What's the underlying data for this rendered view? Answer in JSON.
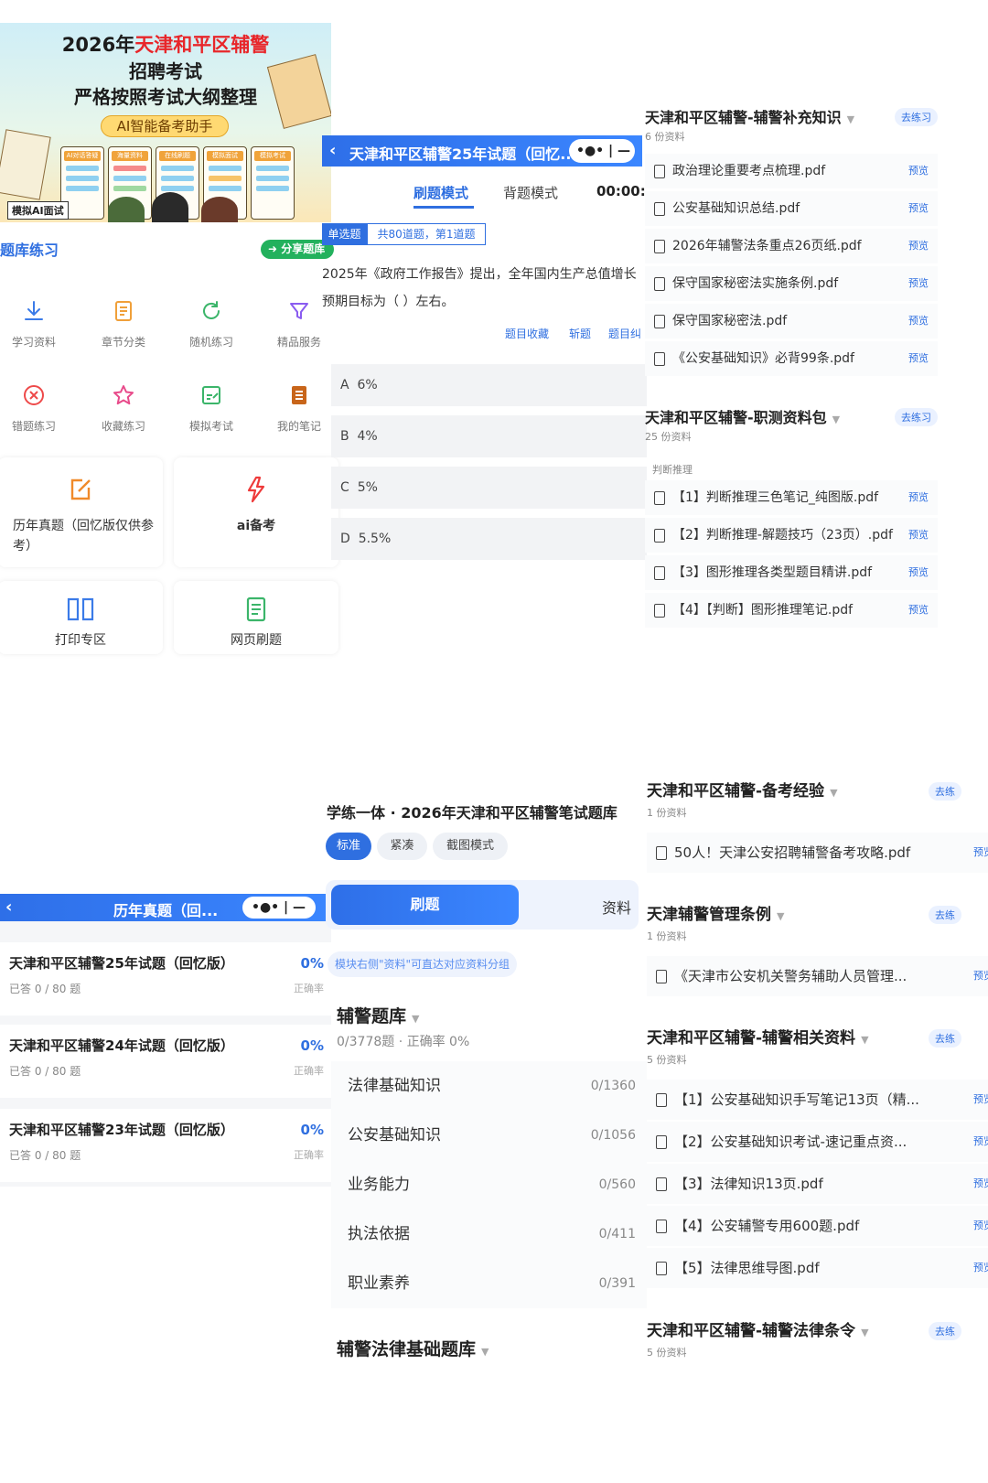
{
  "banner": {
    "title_prefix": "2026年",
    "title_red": "天津和平区辅警",
    "title_line2": "招聘考试",
    "title_line3": "严格按照考试大纲整理",
    "pill": "AI智能备考助手",
    "cards": [
      "AI对话答疑",
      "海量资料",
      "在线刷题",
      "模拟面试",
      "模拟考试"
    ],
    "tag": "模拟AI面试"
  },
  "tiku": {
    "title": "题库练习",
    "share": "分享题库",
    "grid": [
      {
        "label": "学习资料",
        "icon": "download-icon"
      },
      {
        "label": "章节分类",
        "icon": "document-icon"
      },
      {
        "label": "随机练习",
        "icon": "refresh-icon"
      },
      {
        "label": "精品服务",
        "icon": "filter-icon"
      },
      {
        "label": "错题练习",
        "icon": "close-circle-icon"
      },
      {
        "label": "收藏练习",
        "icon": "star-icon"
      },
      {
        "label": "模拟考试",
        "icon": "edit-icon"
      },
      {
        "label": "我的笔记",
        "icon": "notebook-icon"
      }
    ],
    "cards": [
      {
        "label": "历年真题（回忆版仅供参考）",
        "icon": "edit-square-icon"
      },
      {
        "label": "ai备考",
        "icon": "ai-icon"
      },
      {
        "label": "打印专区",
        "icon": "book-icon"
      },
      {
        "label": "网页刷题",
        "icon": "web-doc-icon"
      }
    ]
  },
  "question": {
    "bar_title": "天津和平区辅警25年试题（回忆...",
    "mode_active": "刷题模式",
    "mode_other": "背题模式",
    "timer": "00:00:",
    "type_badge": "单选题",
    "progress": "共80道题，第1道题",
    "text": "2025年《政府工作报告》提出，全年国内生产总值增长预期目标为（    ）左右。",
    "actions": [
      "题目收藏",
      "斩题",
      "题目纠"
    ],
    "options": [
      {
        "key": "A",
        "text": "6%"
      },
      {
        "key": "B",
        "text": "4%"
      },
      {
        "key": "C",
        "text": "5%"
      },
      {
        "key": "D",
        "text": "5.5%"
      }
    ]
  },
  "materials_top": [
    {
      "title": "天津和平区辅警-辅警补充知识",
      "count": "6 份资料",
      "go": "去练习",
      "group": "",
      "files": [
        "政治理论重要考点梳理.pdf",
        "公安基础知识总结.pdf",
        "2026年辅警法条重点26页纸.pdf",
        "保守国家秘密法实施条例.pdf",
        "保守国家秘密法.pdf",
        "《公安基础知识》必背99条.pdf"
      ]
    },
    {
      "title": "天津和平区辅警-职测资料包",
      "count": "25 份资料",
      "go": "去练习",
      "group": "判断推理",
      "files": [
        "【1】判断推理三色笔记_纯图版.pdf",
        "【2】判断推理-解题技巧（23页）.pdf",
        "【3】图形推理各类型题目精讲.pdf",
        "【4】【判断】图形推理笔记.pdf"
      ]
    }
  ],
  "preview_label": "预览",
  "exam_list": {
    "bar_title": "历年真题（回...",
    "items": [
      {
        "title": "天津和平区辅警25年试题（回忆版）",
        "sub": "已答 0 / 80 题",
        "pct": "0%",
        "rate": "正确率"
      },
      {
        "title": "天津和平区辅警24年试题（回忆版）",
        "sub": "已答 0 / 80 题",
        "pct": "0%",
        "rate": "正确率"
      },
      {
        "title": "天津和平区辅警23年试题（回忆版）",
        "sub": "已答 0 / 80 题",
        "pct": "0%",
        "rate": "正确率"
      }
    ]
  },
  "practice": {
    "title": "学练一体 · 2026年天津和平区辅警笔试题库",
    "chips": [
      "标准",
      "紧凑",
      "截图模式"
    ],
    "tab_active": "刷题",
    "tab_other": "资料",
    "hint": "模块右侧\"资料\"可直达对应资料分组",
    "bank_title": "辅警题库",
    "bank_stats": "0/3778题 · 正确率 0%",
    "rows": [
      {
        "name": "法律基础知识",
        "count": "0/1360"
      },
      {
        "name": "公安基础知识",
        "count": "0/1056"
      },
      {
        "name": "业务能力",
        "count": "0/560"
      },
      {
        "name": "执法依据",
        "count": "0/411"
      },
      {
        "name": "职业素养",
        "count": "0/391"
      }
    ],
    "bank2_title": "辅警法律基础题库"
  },
  "materials_bottom": [
    {
      "title": "天津和平区辅警-备考经验",
      "count": "1 份资料",
      "go": "去练",
      "files": [
        "50人！天津公安招聘辅警备考攻略.pdf"
      ]
    },
    {
      "title": "天津辅警管理条例",
      "count": "1 份资料",
      "go": "去练",
      "files": [
        "《天津市公安机关警务辅助人员管理..."
      ]
    },
    {
      "title": "天津和平区辅警-辅警相关资料",
      "count": "5 份资料",
      "go": "去练",
      "files": [
        "【1】公安基础知识手写笔记13页（精...",
        "【2】公安基础知识考试-速记重点资...",
        "【3】法律知识13页.pdf",
        "【4】公安辅警专用600题.pdf",
        "【5】法律思维导图.pdf"
      ]
    },
    {
      "title": "天津和平区辅警-辅警法律条令",
      "count": "5 份资料",
      "go": "去练",
      "files": []
    }
  ],
  "colors": {
    "primary": "#2f6fe0",
    "green": "#23b15d",
    "red": "#e8262a"
  }
}
